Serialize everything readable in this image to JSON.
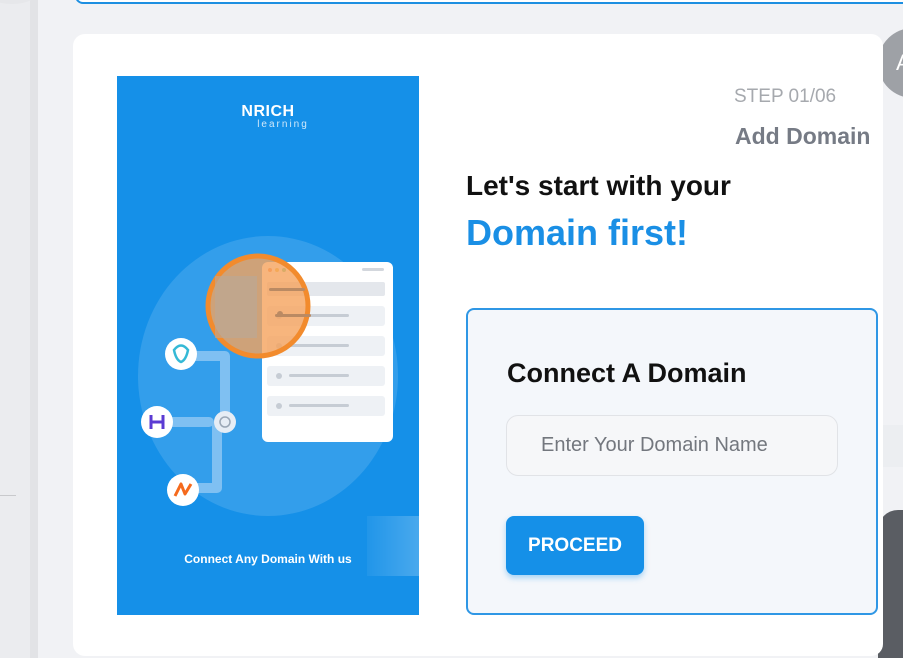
{
  "colors": {
    "accent": "#1590e8",
    "heading_dark": "#111111",
    "step_gray": "#a6a9ae",
    "form_border": "#2f97e5"
  },
  "header": {
    "avatar_initial": "A"
  },
  "promo": {
    "logo_main": "NRICH",
    "logo_sub": "learning",
    "caption": "Connect Any Domain With us"
  },
  "stepper": {
    "step_label": "STEP 01/06",
    "step_title": "Add Domain"
  },
  "headline": {
    "line1": "Let's start with your",
    "line2": "Domain first!"
  },
  "form": {
    "title": "Connect A Domain",
    "input_value": "",
    "input_placeholder": "Enter Your Domain Name",
    "proceed_label": "PROCEED"
  }
}
